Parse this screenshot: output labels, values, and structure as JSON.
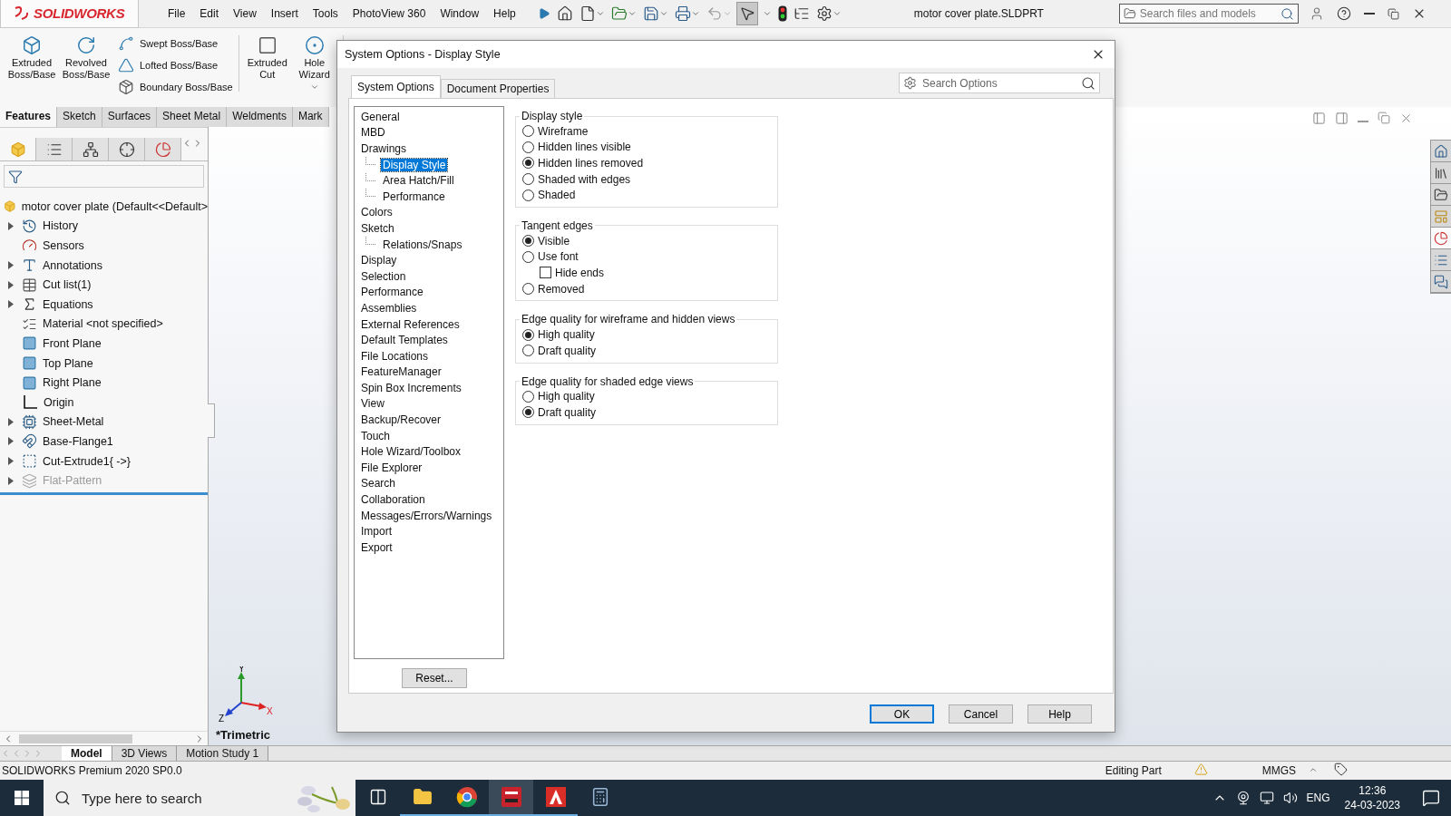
{
  "app": {
    "logo": "SOLIDWORKS",
    "menu": [
      "File",
      "Edit",
      "View",
      "Insert",
      "Tools",
      "PhotoView 360",
      "Window",
      "Help"
    ],
    "document_title": "motor cover plate.SLDPRT",
    "search_placeholder": "Search files and models"
  },
  "ribbon_groups": [
    {
      "buttons": [
        {
          "kind": "large",
          "label": "Extruded Boss/Base",
          "dropdown": false
        },
        {
          "kind": "large",
          "label": "Revolved Boss/Base",
          "dropdown": false
        },
        {
          "kind": "small",
          "label": "Swept Boss/Base",
          "dropdown": false
        },
        {
          "kind": "small",
          "label": "Lofted Boss/Base",
          "dropdown": false
        },
        {
          "kind": "small",
          "label": "Boundary Boss/Base",
          "dropdown": false
        }
      ]
    },
    {
      "buttons": [
        {
          "kind": "large",
          "label": "Extruded Cut",
          "dropdown": false
        },
        {
          "kind": "large",
          "label": "Hole Wizard",
          "dropdown": true
        }
      ]
    }
  ],
  "task_pane": [
    {
      "selected": false
    },
    {
      "selected": false
    },
    {
      "selected": false
    },
    {
      "selected": false
    },
    {
      "selected": true
    },
    {
      "selected": false
    },
    {
      "selected": false
    }
  ],
  "command_tabs": [
    {
      "label": "Features",
      "selected": true
    },
    {
      "label": "Sketch",
      "selected": false
    },
    {
      "label": "Surfaces",
      "selected": false
    },
    {
      "label": "Sheet Metal",
      "selected": false
    },
    {
      "label": "Weldments",
      "selected": false
    },
    {
      "label": "Mark",
      "selected": false
    }
  ],
  "feature_tree": {
    "label": "motor cover plate  (Default<<Default>",
    "children": [
      {
        "label": "History",
        "kind": "history",
        "expandable": true,
        "disabled": false
      },
      {
        "label": "Sensors",
        "kind": "sensors",
        "expandable": false,
        "disabled": false
      },
      {
        "label": "Annotations",
        "kind": "annotations",
        "expandable": true,
        "disabled": false
      },
      {
        "label": "Cut list(1)",
        "kind": "cutlist",
        "expandable": true,
        "disabled": false
      },
      {
        "label": "Equations",
        "kind": "equations",
        "expandable": true,
        "disabled": false
      },
      {
        "label": "Material <not specified>",
        "kind": "material",
        "expandable": false,
        "disabled": false
      },
      {
        "label": "Front Plane",
        "kind": "plane",
        "expandable": false,
        "disabled": false
      },
      {
        "label": "Top Plane",
        "kind": "plane",
        "expandable": false,
        "disabled": false
      },
      {
        "label": "Right Plane",
        "kind": "plane",
        "expandable": false,
        "disabled": false
      },
      {
        "label": "Origin",
        "kind": "origin",
        "expandable": false,
        "disabled": false
      },
      {
        "label": "Sheet-Metal",
        "kind": "sheetmetal",
        "expandable": true,
        "disabled": false
      },
      {
        "label": "Base-Flange1",
        "kind": "flange",
        "expandable": true,
        "disabled": false
      },
      {
        "label": "Cut-Extrude1{ ->}",
        "kind": "cut",
        "expandable": true,
        "disabled": false
      },
      {
        "label": "Flat-Pattern",
        "kind": "flat",
        "expandable": true,
        "disabled": true
      }
    ]
  },
  "viewport": {
    "view_name": "*Trimetric",
    "triad": [
      "X",
      "Y",
      "Z"
    ]
  },
  "bottom_tabs": [
    {
      "label": "Model",
      "selected": true
    },
    {
      "label": "3D Views",
      "selected": false
    },
    {
      "label": "Motion Study 1",
      "selected": false
    }
  ],
  "status_bar": {
    "product": "SOLIDWORKS Premium 2020 SP0.0",
    "mode": "Editing Part",
    "units": "MMGS"
  },
  "taskbar": {
    "search_placeholder": "Type here to search",
    "apps": [
      {
        "kind": "taskview",
        "running": false,
        "selected": false
      },
      {
        "kind": "explorer",
        "running": true,
        "selected": false
      },
      {
        "kind": "chrome",
        "running": true,
        "selected": false
      },
      {
        "kind": "solidworks",
        "running": true,
        "selected": true
      },
      {
        "kind": "autocad",
        "running": true,
        "selected": false
      },
      {
        "kind": "calculator",
        "running": false,
        "selected": false
      }
    ],
    "language": "ENG",
    "time": "12:36",
    "date": "24-03-2023"
  },
  "dialog": {
    "title": "System Options - Display Style",
    "tabs": [
      {
        "label": "System Options",
        "selected": true
      },
      {
        "label": "Document Properties",
        "selected": false
      }
    ],
    "search_placeholder": "Search Options",
    "categories": [
      {
        "label": "General",
        "selected": false
      },
      {
        "label": "MBD",
        "selected": false
      },
      {
        "label": "Drawings",
        "selected": false,
        "children": [
          {
            "label": "Display Style",
            "selected": true
          },
          {
            "label": "Area Hatch/Fill",
            "selected": false
          },
          {
            "label": "Performance",
            "selected": false
          }
        ]
      },
      {
        "label": "Colors",
        "selected": false
      },
      {
        "label": "Sketch",
        "selected": false,
        "children": [
          {
            "label": "Relations/Snaps",
            "selected": false
          }
        ]
      },
      {
        "label": "Display",
        "selected": false
      },
      {
        "label": "Selection",
        "selected": false
      },
      {
        "label": "Performance",
        "selected": false
      },
      {
        "label": "Assemblies",
        "selected": false
      },
      {
        "label": "External References",
        "selected": false
      },
      {
        "label": "Default Templates",
        "selected": false
      },
      {
        "label": "File Locations",
        "selected": false
      },
      {
        "label": "FeatureManager",
        "selected": false
      },
      {
        "label": "Spin Box Increments",
        "selected": false
      },
      {
        "label": "View",
        "selected": false
      },
      {
        "label": "Backup/Recover",
        "selected": false
      },
      {
        "label": "Touch",
        "selected": false
      },
      {
        "label": "Hole Wizard/Toolbox",
        "selected": false
      },
      {
        "label": "File Explorer",
        "selected": false
      },
      {
        "label": "Search",
        "selected": false
      },
      {
        "label": "Collaboration",
        "selected": false
      },
      {
        "label": "Messages/Errors/Warnings",
        "selected": false
      },
      {
        "label": "Import",
        "selected": false
      },
      {
        "label": "Export",
        "selected": false
      }
    ],
    "groups": [
      {
        "title": "Display style",
        "options": [
          {
            "kind": "radio",
            "label": "Wireframe",
            "selected": false
          },
          {
            "kind": "radio",
            "label": "Hidden lines visible",
            "selected": false
          },
          {
            "kind": "radio",
            "label": "Hidden lines removed",
            "selected": true
          },
          {
            "kind": "radio",
            "label": "Shaded with edges",
            "selected": false
          },
          {
            "kind": "radio",
            "label": "Shaded",
            "selected": false
          }
        ]
      },
      {
        "title": "Tangent edges",
        "options": [
          {
            "kind": "radio",
            "label": "Visible",
            "selected": true
          },
          {
            "kind": "radio",
            "label": "Use font",
            "selected": false
          },
          {
            "kind": "checkbox",
            "label": "Hide ends",
            "checked": false
          },
          {
            "kind": "radio",
            "label": "Removed",
            "selected": false
          }
        ]
      },
      {
        "title": "Edge quality for wireframe and hidden views",
        "options": [
          {
            "kind": "radio",
            "label": "High quality",
            "selected": true
          },
          {
            "kind": "radio",
            "label": "Draft quality",
            "selected": false
          }
        ]
      },
      {
        "title": "Edge quality for shaded edge views",
        "options": [
          {
            "kind": "radio",
            "label": "High quality",
            "selected": false
          },
          {
            "kind": "radio",
            "label": "Draft quality",
            "selected": true
          }
        ]
      }
    ],
    "reset": "Reset...",
    "buttons": [
      {
        "label": "OK",
        "default": true
      },
      {
        "label": "Cancel",
        "default": false
      },
      {
        "label": "Help",
        "default": false
      }
    ]
  }
}
